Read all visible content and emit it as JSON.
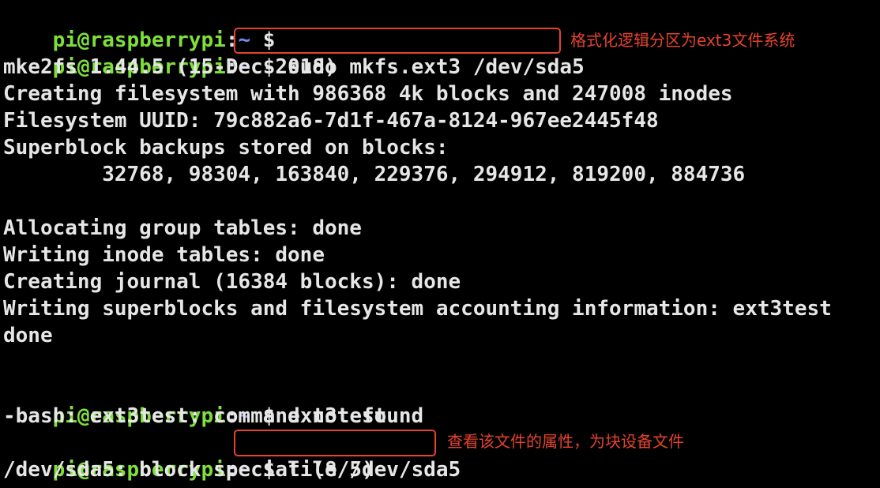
{
  "prompt": {
    "user_host": "pi@raspberrypi",
    "separator": ":",
    "path": "~",
    "dollar": "$"
  },
  "lines": {
    "l0_cmd": " ",
    "l1_cmd": "sudo mkfs.ext3 /dev/sda5",
    "l2": "mke2fs 1.44.5 (15-Dec-2018)",
    "l3": "Creating filesystem with 986368 4k blocks and 247008 inodes",
    "l4": "Filesystem UUID: 79c882a6-7d1f-467a-8124-967ee2445f48",
    "l5": "Superblock backups stored on blocks:",
    "l6": "        32768, 98304, 163840, 229376, 294912, 819200, 884736",
    "l8": "Allocating group tables: done",
    "l9": "Writing inode tables: done",
    "l10": "Creating journal (16384 blocks): done",
    "l11": "Writing superblocks and filesystem accounting information: ext3test",
    "l12": "done",
    "l14_cmd": "ext3test",
    "l15": "-bash: ext3test: command not found",
    "l16_cmd": "file /dev/sda5",
    "l17": "/dev/sda5: block special (8/5)"
  },
  "annotations": {
    "mkfs_note": "格式化逻辑分区为ext3文件系统",
    "file_note": "查看该文件的属性，为块设备文件"
  },
  "colors": {
    "background": "#000000",
    "text": "#e6e6e6",
    "prompt_user": "#7ee03a",
    "prompt_path": "#6f8ff0",
    "annotation": "#e5432e"
  }
}
